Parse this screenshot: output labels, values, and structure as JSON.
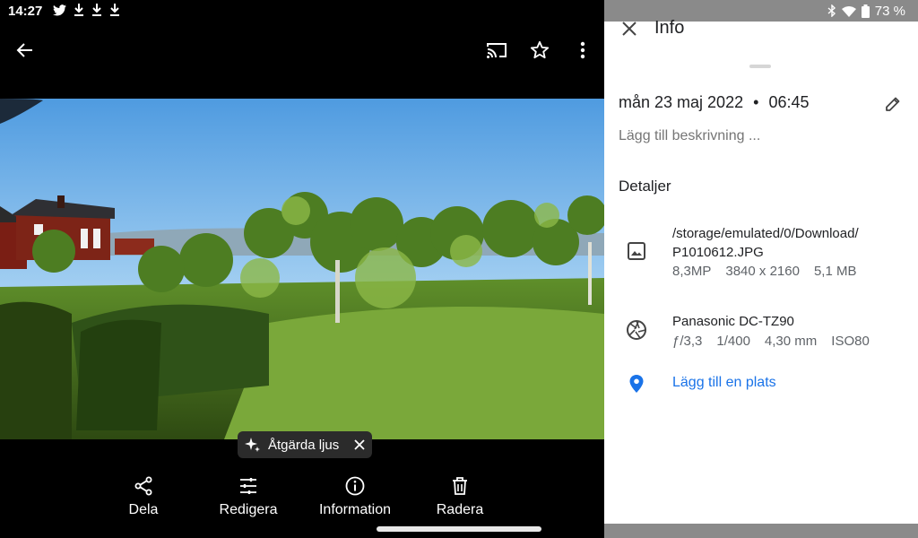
{
  "status_bar": {
    "time": "14:27",
    "battery": "73 %",
    "left_icons": [
      "twitter-icon",
      "download-icon",
      "download-icon",
      "download-icon"
    ],
    "right_icons": [
      "bluetooth-icon",
      "wifi-icon",
      "battery-icon"
    ]
  },
  "viewer": {
    "chip_label": "Åtgärda ljus",
    "actions": [
      {
        "label": "Dela",
        "icon": "share-icon"
      },
      {
        "label": "Redigera",
        "icon": "edit-sliders-icon"
      },
      {
        "label": "Information",
        "icon": "info-icon"
      },
      {
        "label": "Radera",
        "icon": "trash-icon"
      }
    ]
  },
  "info_panel": {
    "title": "Info",
    "date": "mån 23 maj 2022",
    "separator": "•",
    "time": "06:45",
    "description_placeholder": "Lägg till beskrivning ...",
    "details_heading": "Detaljer",
    "file": {
      "path_line1": "/storage/emulated/0/Download/",
      "path_line2": "P1010612.JPG",
      "megapixels": "8,3MP",
      "resolution": "3840 x 2160",
      "size": "5,1 MB"
    },
    "camera": {
      "model": "Panasonic DC-TZ90",
      "aperture": "ƒ/3,3",
      "shutter": "1/400",
      "focal": "4,30 mm",
      "iso": "ISO80"
    },
    "location_label": "Lägg till en plats"
  },
  "colors": {
    "accent": "#1a73e8",
    "panel_bg": "#ffffff",
    "viewer_bg": "#000000"
  }
}
